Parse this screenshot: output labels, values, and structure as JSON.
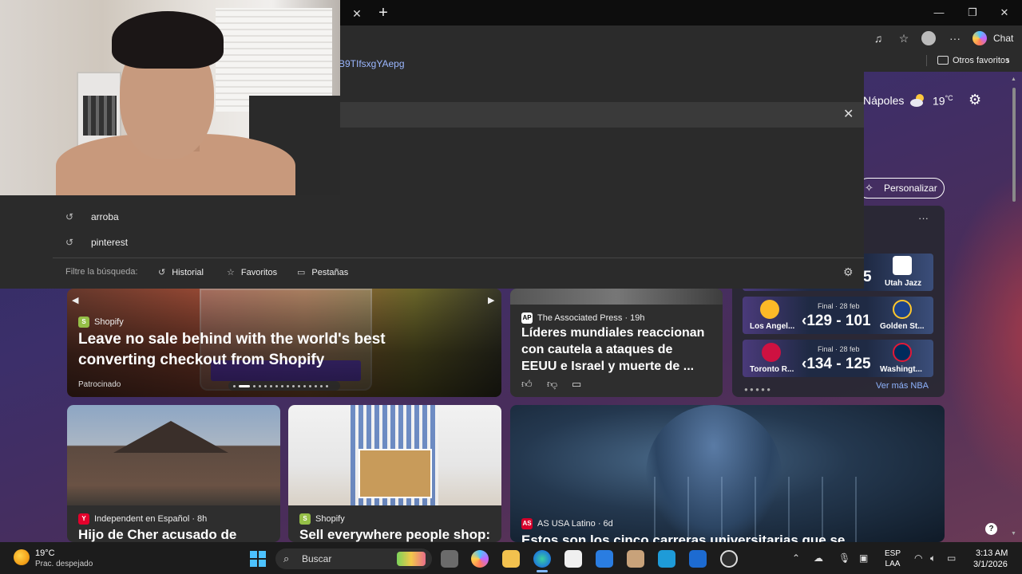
{
  "browser": {
    "tab_close_glyph": "✕",
    "new_tab_glyph": "+",
    "window_minimize": "—",
    "window_restore": "❐",
    "window_close": "✕",
    "toolbar_icons": [
      "music-note-icon",
      "favorites-star-icon",
      "profile-avatar-icon",
      "more-icon",
      "copilot-icon"
    ],
    "more_glyph": "···",
    "chat_label": "Chat",
    "favorites_folder_label": "Otros favoritos",
    "favorites_more_glyph": "›"
  },
  "address": {
    "url_fragment": "B9TIfsxgYAepg",
    "clear_glyph": "✕"
  },
  "suggestions": [
    {
      "icon": "history-icon",
      "text": "arroba"
    },
    {
      "icon": "history-icon",
      "text": "pinterest"
    }
  ],
  "filter": {
    "label": "Filtre la búsqueda:",
    "items": [
      {
        "icon": "history-icon",
        "label": "Historial"
      },
      {
        "icon": "star-icon",
        "label": "Favoritos"
      },
      {
        "icon": "tabs-icon",
        "label": "Pestañas"
      }
    ]
  },
  "weather": {
    "city": "Nápoles",
    "temp": "19",
    "unit": "°C"
  },
  "personalize_label": "Personalizar",
  "hero_card": {
    "source": "Shopify",
    "headline_1": "Leave no sale behind with the world's best",
    "headline_2": "converting checkout from Shopify",
    "sponsored": "Patrocinado",
    "pager_count": 16,
    "pager_active": 1
  },
  "ap_card": {
    "source_logo": "AP",
    "source": "The Associated Press · 19h",
    "headline_1": "Líderes mundiales reaccionan",
    "headline_2": "con cautela a ataques de",
    "headline_3": "EEUU e Israel y muerte de ..."
  },
  "nba": {
    "more_glyph": "···",
    "rows": [
      {
        "left_team": "",
        "final": "",
        "score": "5",
        "right_team": "Utah Jazz"
      },
      {
        "left_team": "Los Angel...",
        "final": "Final · 28 feb",
        "score": "129 - 101",
        "right_team": "Golden St..."
      },
      {
        "left_team": "Toronto R...",
        "final": "Final · 28 feb",
        "score": "134 - 125",
        "right_team": "Washingt..."
      }
    ],
    "pager": "● ● ● ● ●",
    "link": "Ver más NBA"
  },
  "card_house": {
    "source_logo": "Y",
    "source": "Independent en Español · 8h",
    "headline": "Hijo de Cher acusado de"
  },
  "card_shop2": {
    "source": "Shopify",
    "headline": "Sell everywhere people shop:"
  },
  "card_tech": {
    "source_logo": "AS",
    "source": "AS USA Latino · 6d",
    "headline": "Estos son los cinco carreras universitarias que se"
  },
  "help_glyph": "?",
  "taskbar": {
    "temp": "19°C",
    "condition": "Prac. despejado",
    "search_label": "Buscar",
    "lang_1": "ESP",
    "lang_2": "LAA",
    "time": "3:13 AM",
    "date": "3/1/2026"
  },
  "colors": {
    "accent": "#4cc2ff",
    "link": "#8fb4ff",
    "shopify_green": "#95bf47",
    "ap_red": "#e4002b"
  }
}
